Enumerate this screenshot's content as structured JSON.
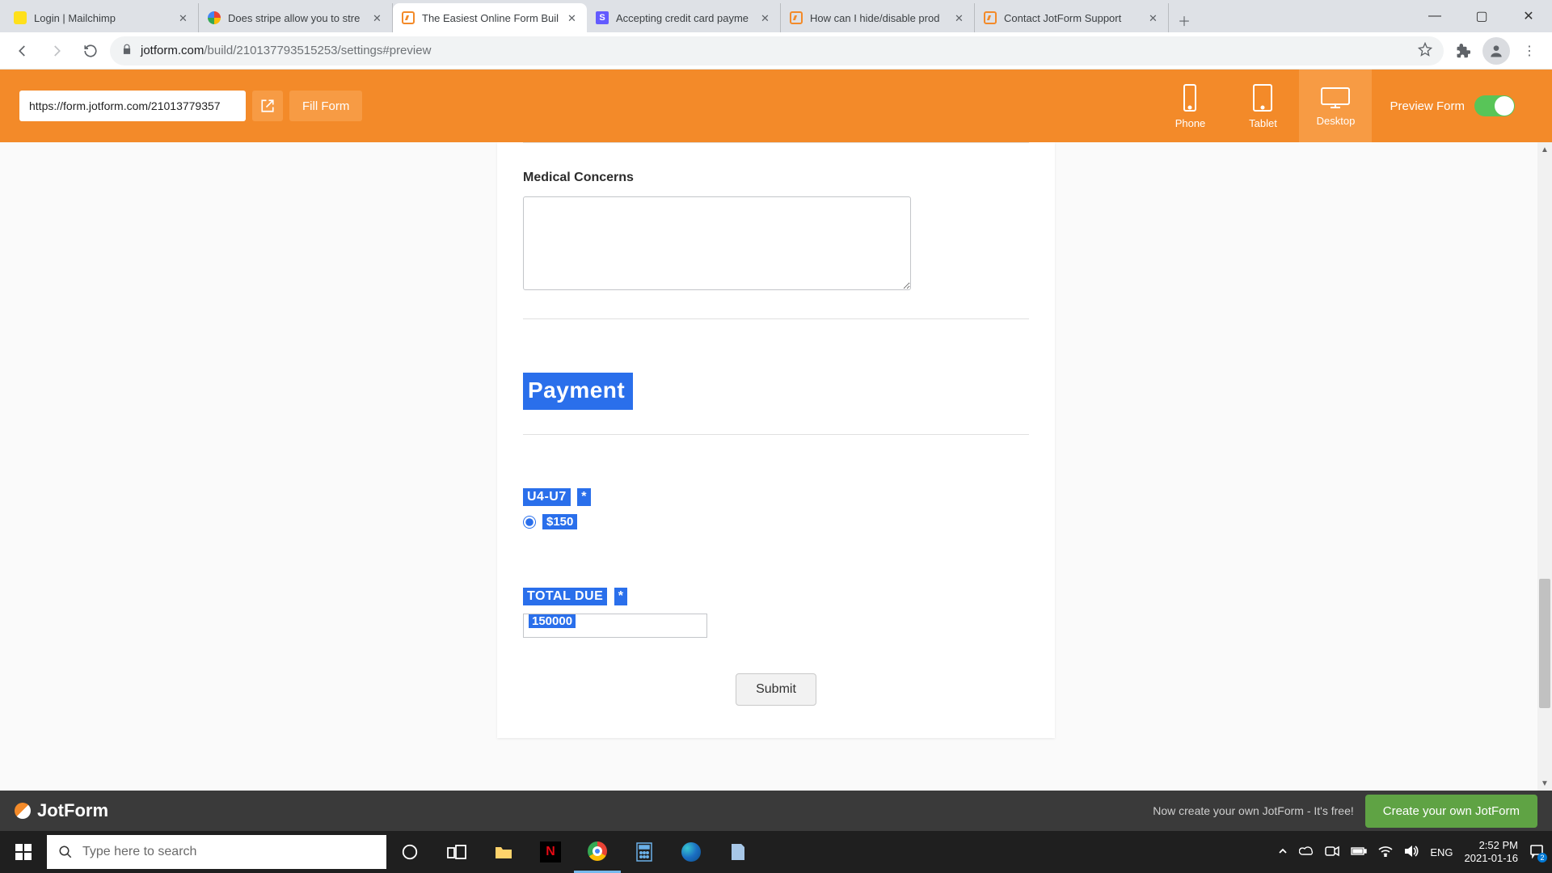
{
  "browser": {
    "tabs": [
      {
        "label": "Login | Mailchimp"
      },
      {
        "label": "Does stripe allow you to stre"
      },
      {
        "label": "The Easiest Online Form Buil"
      },
      {
        "label": "Accepting credit card payme"
      },
      {
        "label": "How can I hide/disable prod"
      },
      {
        "label": "Contact JotForm Support"
      }
    ],
    "stripe_favicon_letter": "S",
    "url_host": "jotform.com",
    "url_path": "/build/210137793515253/settings#preview"
  },
  "jotbar": {
    "form_url": "https://form.jotform.com/21013779357",
    "fill_label": "Fill Form",
    "devices": {
      "phone": "Phone",
      "tablet": "Tablet",
      "desktop": "Desktop"
    },
    "preview_label": "Preview Form"
  },
  "form": {
    "medical_label": "Medical Concerns",
    "payment_heading": "Payment",
    "u4u7_label": "U4-U7",
    "asterisk": "*",
    "u4u7_price": "$150",
    "total_due_label": "TOTAL DUE",
    "total_due_value": "150000",
    "submit_label": "Submit"
  },
  "footer": {
    "brand": "JotForm",
    "tagline": "Now create your own JotForm - It's free!",
    "cta": "Create your own JotForm"
  },
  "taskbar": {
    "search_placeholder": "Type here to search",
    "lang": "ENG",
    "time": "2:52 PM",
    "date": "2021-01-16"
  }
}
